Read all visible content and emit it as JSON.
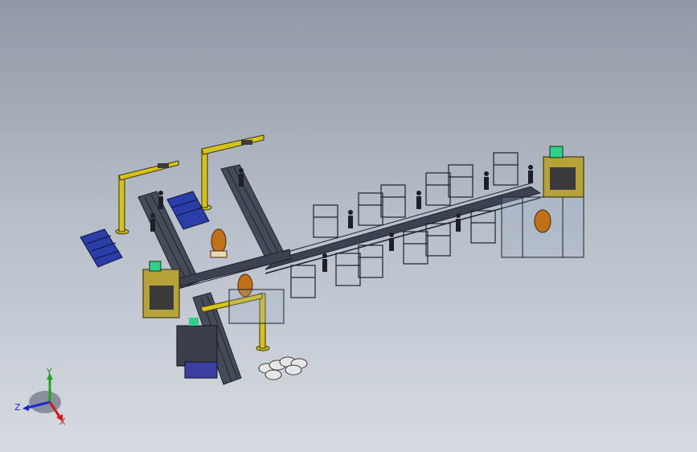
{
  "triad": {
    "x_label": "X",
    "y_label": "Y",
    "z_label": "Z",
    "x_color": "#d01818",
    "y_color": "#1aa51a",
    "z_color": "#1a2ad0"
  },
  "colors": {
    "crane": "#d6c21a",
    "frame": "#2a2f3a",
    "pallet": "#2b3ea8",
    "robot": "#c07018",
    "screen": "#2fd08a",
    "cabinet": "#b7a23a"
  }
}
